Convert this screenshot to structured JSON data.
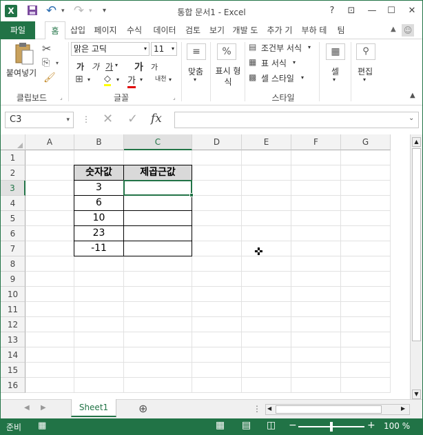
{
  "window": {
    "title": "통합 문서1 - Excel",
    "help": "?",
    "restore_ribbon": "⊡",
    "minimize": "—",
    "maximize": "☐",
    "close": "✕"
  },
  "quick_access": {
    "excel_logo": "X",
    "undo": "↶",
    "redo": "↷",
    "customize": "▾"
  },
  "tabs": [
    "파일",
    "홈",
    "삽입",
    "페이지",
    "수식",
    "데이터",
    "검토",
    "보기",
    "개발 도",
    "추가 기",
    "부하 테",
    "팀"
  ],
  "user_icon": "☺",
  "ribbon": {
    "clipboard": {
      "paste": "붙여넣기",
      "cut_icon": "scissors-icon",
      "copy_icon": "copy-icon",
      "format_painter_icon": "brush-icon",
      "label": "클립보드"
    },
    "font": {
      "name": "맑은 고딕",
      "size": "11",
      "grow": "가",
      "shrink": "가",
      "bold": "가",
      "italic": "가",
      "underline": "가",
      "phonetic": "내천",
      "fill_glyph": "◇",
      "font_color_glyph": "가",
      "label": "글꼴",
      "font_color": "#e00000",
      "fill_color": "#ffff00"
    },
    "alignment": {
      "label": "맞춤"
    },
    "number": {
      "percent": "%",
      "label": "표시 형식"
    },
    "styles": {
      "conditional": "조건부 서식",
      "table": "표 서식",
      "cell": "셀 스타일",
      "label": "스타일"
    },
    "cells": {
      "label": "셀"
    },
    "editing": {
      "label": "편집"
    }
  },
  "formula_bar": {
    "name_box": "C3",
    "cancel": "✕",
    "enter": "✓",
    "fx": "fx",
    "value": ""
  },
  "grid": {
    "columns": [
      "A",
      "B",
      "C",
      "D",
      "E",
      "F",
      "G"
    ],
    "rows": [
      "1",
      "2",
      "3",
      "4",
      "5",
      "6",
      "7",
      "8",
      "9",
      "10",
      "11",
      "12",
      "13",
      "14",
      "15",
      "16"
    ],
    "selected_cell": "C3",
    "table": {
      "headers": [
        "숫자값",
        "제곱근값"
      ],
      "values": [
        "3",
        "6",
        "10",
        "23",
        "-11"
      ],
      "results": [
        "",
        "",
        "",
        "",
        ""
      ]
    }
  },
  "sheets": {
    "active": "Sheet1",
    "add": "⊕"
  },
  "status": {
    "ready": "준비",
    "zoom": "100 %",
    "zoom_minus": "−",
    "zoom_plus": "+"
  },
  "colors": {
    "accent": "#217346"
  }
}
